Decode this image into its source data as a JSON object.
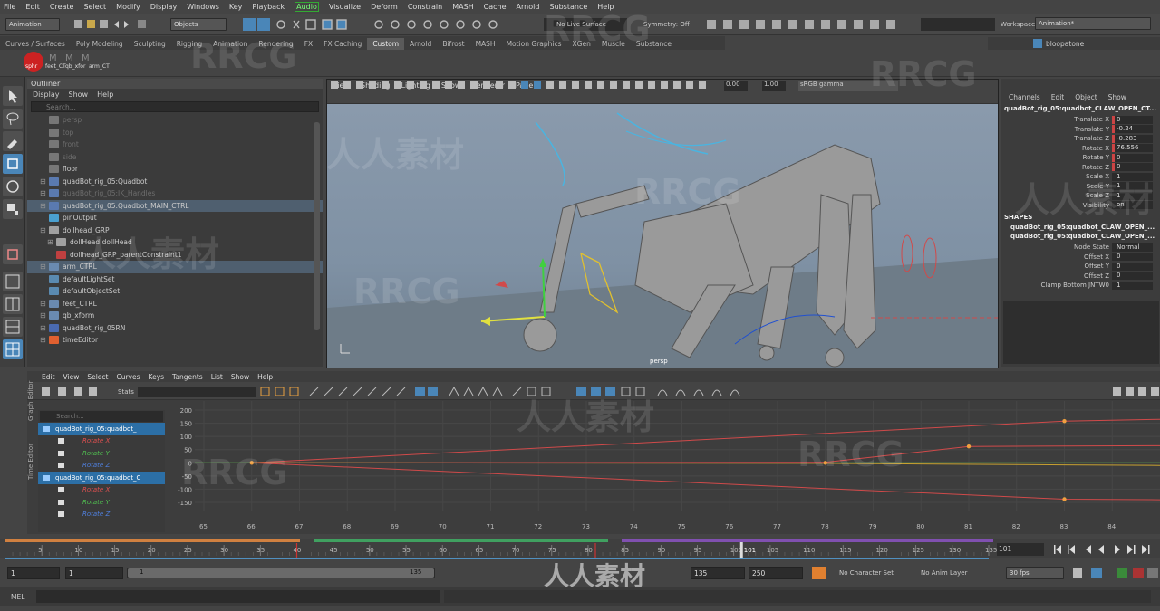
{
  "menubar": [
    "File",
    "Edit",
    "Create",
    "Select",
    "Modify",
    "Display",
    "Windows",
    "Key",
    "Playback",
    "Audio",
    "Visualize",
    "Deform",
    "Constrain",
    "MASH",
    "Cache",
    "Arnold",
    "Substance",
    "Help"
  ],
  "toolbar": {
    "mode": "Animation",
    "objects_label": "Objects",
    "live_surface": "No Live Surface",
    "symmetry": "Symmetry: Off",
    "workspace_label": "Workspace :",
    "workspace_value": "Animation*",
    "user": "bloopatone"
  },
  "shelf_tabs": [
    "Curves / Surfaces",
    "Poly Modeling",
    "Sculpting",
    "Rigging",
    "Animation",
    "Rendering",
    "FX",
    "FX Caching",
    "Custom",
    "Arnold",
    "Bifrost",
    "MASH",
    "Motion Graphics",
    "XGen",
    "Muscle",
    "Substance"
  ],
  "shelf_active": "Custom",
  "shelf_items": [
    "sphr",
    "feet_CT",
    "qb_xfor",
    "arm_CT"
  ],
  "outliner": {
    "title": "Outliner",
    "menu": [
      "Display",
      "Show",
      "Help"
    ],
    "search_placeholder": "Search...",
    "items": [
      {
        "label": "persp",
        "dim": true,
        "exp": ""
      },
      {
        "label": "top",
        "dim": true,
        "exp": ""
      },
      {
        "label": "front",
        "dim": true,
        "exp": ""
      },
      {
        "label": "side",
        "dim": true,
        "exp": ""
      },
      {
        "label": "floor",
        "dim": false,
        "exp": ""
      },
      {
        "label": "quadBot_rig_05:Quadbot",
        "dim": false,
        "exp": "⊞"
      },
      {
        "label": "quadBot_rig_05:IK_Handles",
        "dim": true,
        "exp": "⊞"
      },
      {
        "label": "quadBot_rig_05:Quadbot_MAIN_CTRL",
        "dim": false,
        "exp": "⊞",
        "sel": true
      },
      {
        "label": "pinOutput",
        "dim": false,
        "exp": ""
      },
      {
        "label": "dollhead_GRP",
        "dim": false,
        "exp": "⊟"
      },
      {
        "label": "dollHead:dollHead",
        "dim": false,
        "exp": "⊞",
        "indent": true
      },
      {
        "label": "dollhead_GRP_parentConstraint1",
        "dim": false,
        "exp": "",
        "indent": true
      },
      {
        "label": "arm_CTRL",
        "dim": false,
        "exp": "⊞",
        "sel": true
      },
      {
        "label": "defaultLightSet",
        "dim": false,
        "exp": ""
      },
      {
        "label": "defaultObjectSet",
        "dim": false,
        "exp": ""
      },
      {
        "label": "feet_CTRL",
        "dim": false,
        "exp": "⊞"
      },
      {
        "label": "qb_xform",
        "dim": false,
        "exp": "⊞"
      },
      {
        "label": "quadBot_rig_05RN",
        "dim": false,
        "exp": "⊞"
      },
      {
        "label": "timeEditor",
        "dim": false,
        "exp": "⊞"
      }
    ]
  },
  "viewport": {
    "menu": [
      "View",
      "Shading",
      "Lighting",
      "Show",
      "Renderer",
      "Panels"
    ],
    "exposure": "0.00",
    "gamma": "1.00",
    "colorspace": "sRGB gamma",
    "camera_label": "persp"
  },
  "channel_box": {
    "menu": [
      "Channels",
      "Edit",
      "Object",
      "Show"
    ],
    "node": "quadBot_rig_05:quadbot_CLAW_OPEN_CT...",
    "attrs": [
      {
        "label": "Translate X",
        "value": "0",
        "color": "#c44"
      },
      {
        "label": "Translate Y",
        "value": "-0.24",
        "color": "#c44"
      },
      {
        "label": "Translate Z",
        "value": "-0.283",
        "color": "#c44"
      },
      {
        "label": "Rotate X",
        "value": "76.556",
        "color": "#c44"
      },
      {
        "label": "Rotate Y",
        "value": "0",
        "color": "#c44"
      },
      {
        "label": "Rotate Z",
        "value": "0",
        "color": "#c44"
      },
      {
        "label": "Scale X",
        "value": "1",
        "color": ""
      },
      {
        "label": "Scale Y",
        "value": "1",
        "color": ""
      },
      {
        "label": "Scale Z",
        "value": "1",
        "color": ""
      },
      {
        "label": "Visibility",
        "value": "on",
        "color": ""
      }
    ],
    "shapes_title": "SHAPES",
    "shapes": [
      "quadBot_rig_05:quadbot_CLAW_OPEN_...",
      "quadBot_rig_05:quadbot_CLAW_OPEN_..."
    ],
    "shape_attrs": [
      {
        "label": "Node State",
        "value": "Normal"
      },
      {
        "label": "Offset X",
        "value": "0"
      },
      {
        "label": "Offset Y",
        "value": "0"
      },
      {
        "label": "Offset Z",
        "value": "0"
      },
      {
        "label": "Clamp Bottom JNTW0",
        "value": "1"
      }
    ]
  },
  "graph_editor": {
    "side_label": "Graph Editor",
    "side_label2": "Time Editor",
    "menu": [
      "Edit",
      "View",
      "Select",
      "Curves",
      "Keys",
      "Tangents",
      "List",
      "Show",
      "Help"
    ],
    "stats": "Stats",
    "search_placeholder": "Search...",
    "list": [
      {
        "label": "quadBot_rig_05:quadbot_",
        "type": "node"
      },
      {
        "label": "Rotate X",
        "type": "x"
      },
      {
        "label": "Rotate Y",
        "type": "y"
      },
      {
        "label": "Rotate Z",
        "type": "z"
      },
      {
        "label": "quadBot_rig_05:quadbot_C",
        "type": "node"
      },
      {
        "label": "Rotate X",
        "type": "x"
      },
      {
        "label": "Rotate Y",
        "type": "y"
      },
      {
        "label": "Rotate Z",
        "type": "z"
      }
    ],
    "y_ticks": [
      "200",
      "150",
      "100",
      "50",
      "0",
      "-50",
      "-100",
      "-150"
    ],
    "x_ticks": [
      "65",
      "66",
      "67",
      "68",
      "69",
      "70",
      "71",
      "72",
      "73",
      "74",
      "75",
      "76",
      "77",
      "78",
      "79",
      "80",
      "81",
      "82",
      "83",
      "84"
    ]
  },
  "timeline": {
    "ticks": [
      "5",
      "10",
      "15",
      "20",
      "25",
      "30",
      "35",
      "40",
      "45",
      "50",
      "55",
      "60",
      "65",
      "70",
      "75",
      "80",
      "85",
      "90",
      "95",
      "100",
      "105",
      "110",
      "115",
      "120",
      "125",
      "130",
      "135"
    ],
    "current": "101",
    "current_field": "101"
  },
  "range": {
    "start": "1",
    "start2": "1",
    "slider_start": "1",
    "slider_end": "135",
    "end": "135",
    "end2": "250",
    "character_set": "No Character Set",
    "anim_layer": "No Anim Layer",
    "fps": "30 fps"
  },
  "mel": {
    "label": "MEL"
  },
  "watermarks": [
    "RRCG",
    "人人素材"
  ],
  "colors": {
    "accent": "#4a86b8",
    "selection": "#2c6fa6",
    "curve_red": "#d04a4a",
    "curve_green": "#5ab04a",
    "key": "#f0a040"
  }
}
